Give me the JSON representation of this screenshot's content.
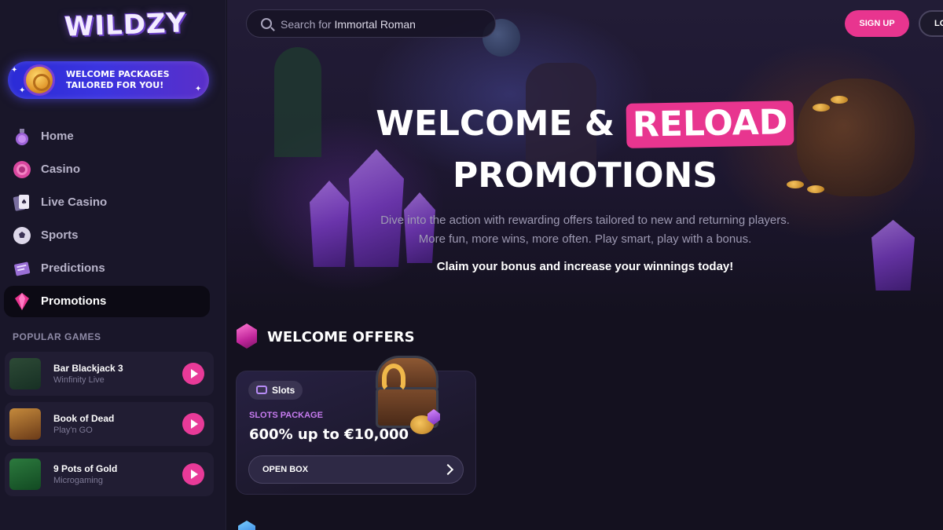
{
  "brand": {
    "logo_text": "WILDZY"
  },
  "sidebar": {
    "promo_banner": "WELCOME PACKAGES TAILORED FOR YOU!",
    "nav": [
      {
        "label": "Home",
        "icon": "potion-icon",
        "active": false
      },
      {
        "label": "Casino",
        "icon": "casino-chip-icon",
        "active": false
      },
      {
        "label": "Live Casino",
        "icon": "playing-cards-icon",
        "active": false
      },
      {
        "label": "Sports",
        "icon": "soccer-ball-icon",
        "active": false
      },
      {
        "label": "Predictions",
        "icon": "ticket-icon",
        "active": false
      },
      {
        "label": "Promotions",
        "icon": "gem-icon",
        "active": true
      }
    ],
    "popular_title": "POPULAR GAMES",
    "games": [
      {
        "name": "Bar Blackjack 3",
        "provider": "Winfinity Live"
      },
      {
        "name": "Book of Dead",
        "provider": "Play'n GO"
      },
      {
        "name": "9 Pots of Gold",
        "provider": "Microgaming"
      }
    ]
  },
  "header": {
    "search_prefix": "Search for",
    "search_value": "Immortal Roman",
    "signup_label": "SIGN UP",
    "login_label": "LO"
  },
  "hero": {
    "title_part1": "WELCOME &",
    "title_highlight": "RELOAD",
    "title_part2": "PROMOTIONS",
    "desc_line1": "Dive into the action with rewarding offers tailored to new and returning players.",
    "desc_line2": "More fun, more wins, more often. Play smart, play with a bonus.",
    "claim": "Claim your bonus and increase your winnings today!"
  },
  "offers": {
    "section_title": "WELCOME OFFERS",
    "card": {
      "tag": "Slots",
      "package": "SLOTS PACKAGE",
      "amount": "600% up to €10,000",
      "button": "OPEN BOX"
    }
  },
  "colors": {
    "accent_pink": "#e8358f",
    "sidebar_bg": "#191629",
    "main_bg": "#14111f",
    "package_label": "#c77cf0"
  }
}
